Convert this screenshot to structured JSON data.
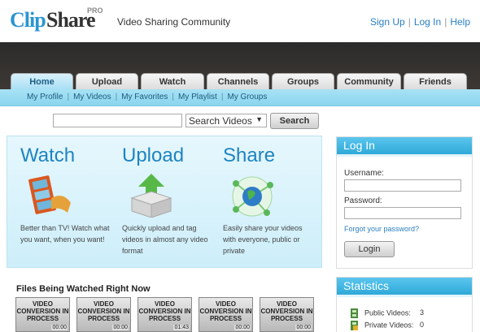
{
  "header": {
    "logo": {
      "part1": "Clip",
      "part2": "Share",
      "badge": "PRO"
    },
    "tagline": "Video Sharing Community",
    "links": [
      "Sign Up",
      "Log In",
      "Help"
    ]
  },
  "tabs": [
    "Home",
    "Upload",
    "Watch",
    "Channels",
    "Groups",
    "Community",
    "Friends"
  ],
  "subnav": [
    "My Profile",
    "My Videos",
    "My Favorites",
    "My Playlist",
    "My Groups"
  ],
  "search": {
    "placeholder": "",
    "select_value": "Search Videos",
    "button": "Search"
  },
  "hero": [
    {
      "title": "Watch",
      "desc": "Better than TV! Watch what you want, when you want!",
      "icon": "film-reel-icon"
    },
    {
      "title": "Upload",
      "desc": "Quickly upload and tag videos in almost any video format",
      "icon": "upload-box-icon"
    },
    {
      "title": "Share",
      "desc": "Easily share your videos with everyone, public or private",
      "icon": "globe-network-icon"
    }
  ],
  "files": {
    "title": "Files Being Watched Right Now",
    "thumb_text": "VIDEO CONVERSION IN PROCESS",
    "durations": [
      "00:00",
      "00:00",
      "01:43",
      "00:00",
      "00:00"
    ]
  },
  "login": {
    "title": "Log In",
    "username_label": "Username:",
    "password_label": "Password:",
    "forgot": "Forgot your password?",
    "button": "Login"
  },
  "stats": {
    "title": "Statistics",
    "rows": [
      {
        "label": "Public Videos:",
        "value": "3"
      },
      {
        "label": "Private Videos:",
        "value": "0"
      }
    ]
  },
  "colors": {
    "accent": "#2a95d3",
    "subnav": "#a8e2f5",
    "dark_band": "#2b2b2b"
  }
}
